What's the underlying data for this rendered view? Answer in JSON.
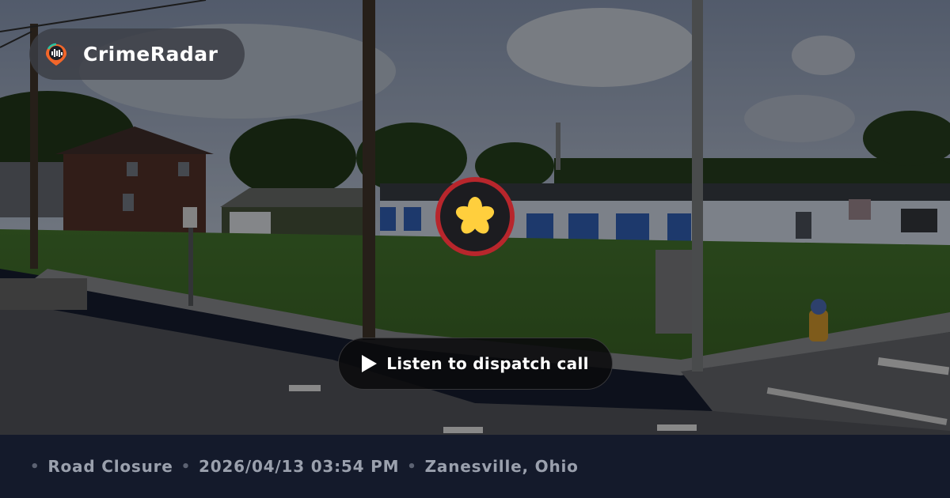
{
  "brand": {
    "name": "CrimeRadar",
    "logo": "radar-pin-logo-icon"
  },
  "marker": {
    "icon": "asterisk-burst-icon",
    "ring_color": "#b8262c",
    "fill_color": "#ffcf3d"
  },
  "action": {
    "label": "Listen to dispatch call",
    "icon": "play-icon"
  },
  "incident": {
    "type": "Road Closure",
    "datetime": "2026/04/13 03:54 PM",
    "location": "Zanesville, Ohio",
    "separator": "•"
  },
  "colors": {
    "footer_bg": "#141a2b",
    "meta_text": "#9aa0ad",
    "brand_pill": "#3c3e46"
  }
}
